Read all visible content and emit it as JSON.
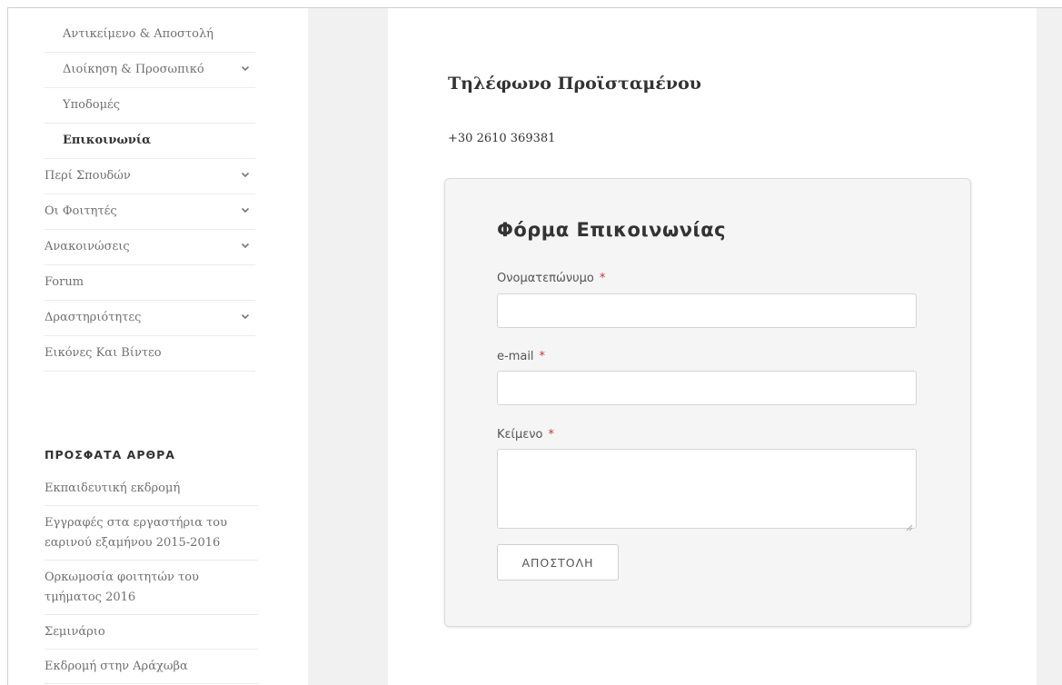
{
  "nav": {
    "items": [
      {
        "label": "Αντικείμενο & Αποστολή",
        "sub": true
      },
      {
        "label": "Διοίκηση & Προσωπικό",
        "sub": true,
        "chevron": true
      },
      {
        "label": "Υποδομές",
        "sub": true
      },
      {
        "label": "Επικοινωνία",
        "sub": true,
        "active": true
      },
      {
        "label": "Περί Σπουδών",
        "chevron": true
      },
      {
        "label": "Οι Φοιτητές",
        "chevron": true
      },
      {
        "label": "Ανακοινώσεις",
        "chevron": true
      },
      {
        "label": "Forum"
      },
      {
        "label": "Δραστηριότητες",
        "chevron": true
      },
      {
        "label": "Εικόνες Και Βίντεο"
      }
    ]
  },
  "recent": {
    "title": "ΠΡΟΣΦΑΤΑ ΑΡΘΡΑ",
    "items": [
      "Εκπαιδευτική εκδρομή",
      "Εγγραφές στα εργαστήρια του εαρινού εξαμήνου 2015-2016",
      "Ορκωμοσία φοιτητών του τμήματος 2016",
      "Σεμινάριο",
      "Εκδρομή στην Αράχωβα"
    ]
  },
  "main": {
    "phone_title": "Τηλέφωνο Προϊσταμένου",
    "phone_number": "+30 2610 369381"
  },
  "form": {
    "title": "Φόρμα Επικοινωνίας",
    "name_label": "Ονοματεπώνυμο",
    "email_label": "e-mail",
    "text_label": "Κείμενο",
    "required_mark": "*",
    "name_value": "",
    "email_value": "",
    "text_value": "",
    "submit_label": "ΑΠΟΣΤΟΛΗ"
  },
  "colors": {
    "required": "#cc3333",
    "gutter": "#f1f1f1",
    "form_bg": "#f5f5f5"
  }
}
